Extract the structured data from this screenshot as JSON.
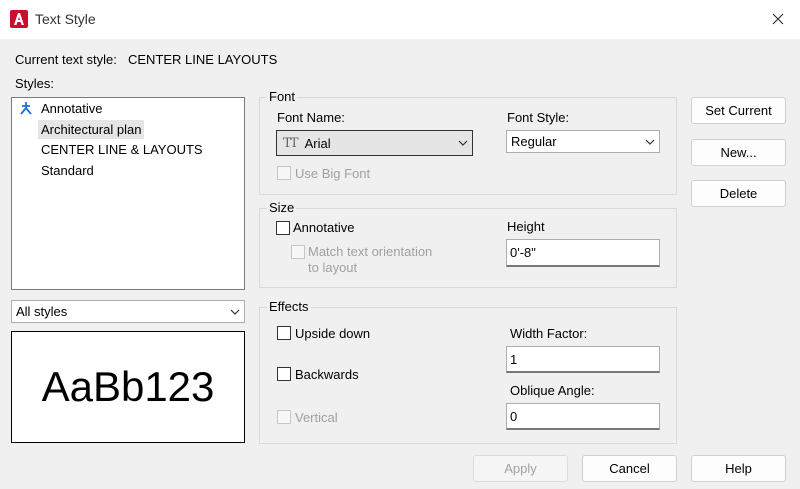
{
  "window": {
    "title": "Text Style"
  },
  "current_style": {
    "label": "Current text style:",
    "value": "CENTER LINE  LAYOUTS"
  },
  "styles": {
    "label": "Styles:",
    "items": [
      "Annotative",
      "Architectural plan",
      "CENTER LINE & LAYOUTS",
      "Standard"
    ],
    "selected_index": 1,
    "filter_value": "All styles"
  },
  "preview": {
    "text": "AaBb123"
  },
  "font": {
    "group_title": "Font",
    "name_label": "Font Name:",
    "name_value": "Arial",
    "style_label": "Font Style:",
    "style_value": "Regular",
    "big_font_label": "Use Big Font"
  },
  "size": {
    "group_title": "Size",
    "annotative_label": "Annotative",
    "match_line1": "Match text orientation",
    "match_line2": "to layout",
    "height_label": "Height",
    "height_value": "0'-8\""
  },
  "effects": {
    "group_title": "Effects",
    "upside_down_label": "Upside down",
    "backwards_label": "Backwards",
    "vertical_label": "Vertical",
    "width_factor_label": "Width Factor:",
    "width_factor_value": "1",
    "oblique_label": "Oblique Angle:",
    "oblique_value": "0"
  },
  "buttons": {
    "set_current": "Set Current",
    "new": "New...",
    "delete": "Delete",
    "apply": "Apply",
    "cancel": "Cancel",
    "help": "Help"
  },
  "colors": {
    "app_icon": "#c8102e",
    "annotative_icon": "#1e6fd9"
  }
}
